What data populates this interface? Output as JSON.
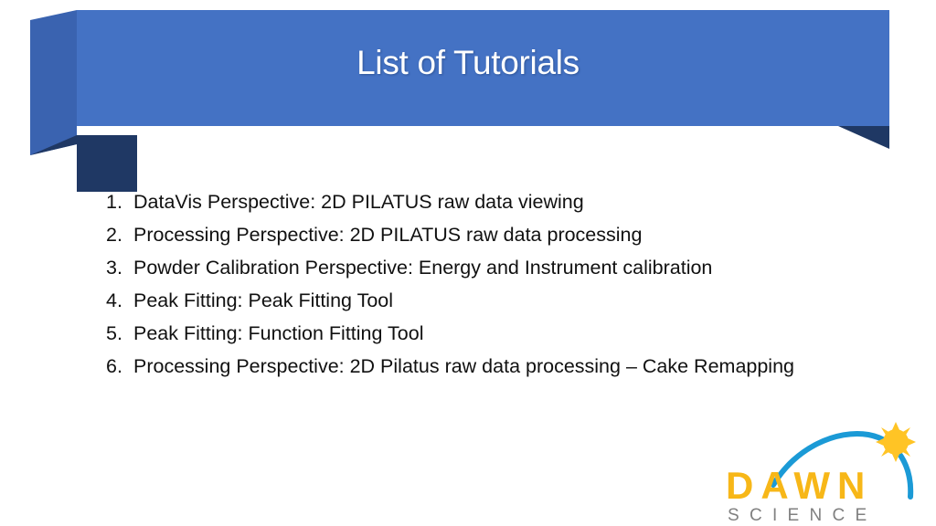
{
  "slide": {
    "title": "List of Tutorials",
    "banner_color": "#4472C4",
    "banner_fold_color": "#1F3864",
    "banner_side_color": "#3A63B0",
    "title_color": "#FFFFFF",
    "background_color": "#FFFFFF"
  },
  "tutorials": [
    {
      "number": "1.",
      "text": "DataVis Perspective: 2D PILATUS raw data viewing"
    },
    {
      "number": "2.",
      "text": "Processing Perspective: 2D PILATUS raw data processing"
    },
    {
      "number": "3.",
      "text": "Powder Calibration Perspective: Energy and Instrument calibration"
    },
    {
      "number": "4.",
      "text": "Peak Fitting: Peak Fitting Tool"
    },
    {
      "number": "5.",
      "text": "Peak Fitting: Function Fitting Tool"
    },
    {
      "number": "6.",
      "text": "Processing Perspective: 2D Pilatus raw data processing – Cake Remapping"
    }
  ],
  "logo": {
    "primary_text": "DAWN",
    "secondary_text": "S C I E N C E",
    "primary_color": "#F7B718",
    "secondary_color": "#808080",
    "arc_color": "#1B9AD6",
    "sun_color": "#FFC425"
  }
}
